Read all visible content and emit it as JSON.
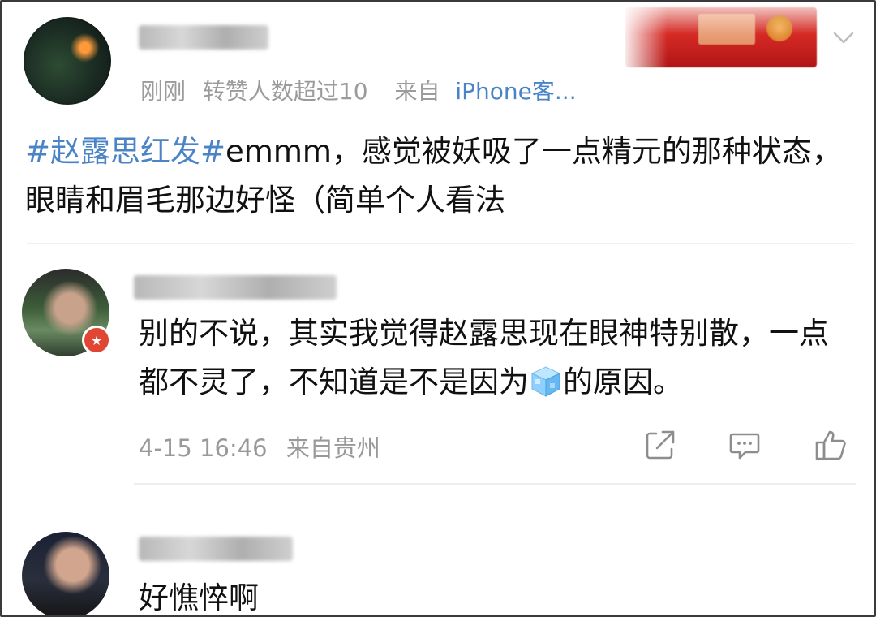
{
  "post": {
    "meta_time": "刚刚",
    "meta_reposts": "转赞人数超过10",
    "meta_from": "来自",
    "meta_source": "iPhone客...",
    "hashtag": "#赵露思红发#",
    "text": "emmm，感觉被妖吸了一点精元的那种状态，眼睛和眉毛那边好怪（简单个人看法"
  },
  "comments": [
    {
      "text_before_emoji": "别的不说，其实我觉得赵露思现在眼神特别散，一点都不灵了，不知道是不是因为",
      "text_after_emoji": "的原因。",
      "time": "4-15 16:46",
      "location": "来自贵州",
      "badge": "★",
      "emoji_name": "ice-cube-emoji"
    },
    {
      "text": "好憔悴啊"
    }
  ],
  "icons": {
    "chevron": "chevron-down-icon",
    "share": "share-icon",
    "comment": "comment-icon",
    "like": "thumbs-up-icon"
  },
  "colors": {
    "link": "#4a83c6",
    "meta": "#9b9b9b",
    "badge": "#e04633"
  }
}
